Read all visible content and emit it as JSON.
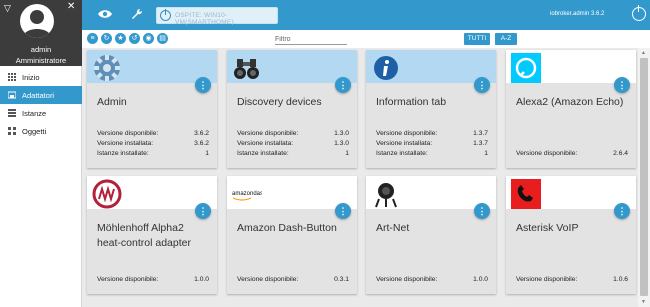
{
  "profile": {
    "name": "admin",
    "role": "Amministratore"
  },
  "nav": [
    {
      "label": "Inizio",
      "icon": "grid-icon"
    },
    {
      "label": "Adattatori",
      "icon": "store-icon",
      "active": true
    },
    {
      "label": "Istanze",
      "icon": "list-icon"
    },
    {
      "label": "Oggetti",
      "icon": "objects-icon"
    }
  ],
  "header": {
    "host_label": "OSPITE: WIN10-VM(SMARTHOME)",
    "account": "iobroker.admin 3.6.2"
  },
  "toolbar": {
    "filter_placeholder": "Filtro",
    "btn_all": "TUTTI",
    "btn_sort": "A-Z"
  },
  "labels": {
    "available": "Versione disponibile:",
    "installed": "Versione installata:",
    "instances": "Istanze installate:"
  },
  "cards": [
    {
      "title": "Admin",
      "available": "3.6.2",
      "installed": "3.6.2",
      "instances": "1",
      "logo": "gear-logo",
      "installed_flag": true
    },
    {
      "title": "Discovery devices",
      "available": "1.3.0",
      "installed": "1.3.0",
      "instances": "1",
      "logo": "binoculars-logo",
      "installed_flag": true
    },
    {
      "title": "Information tab",
      "available": "1.3.7",
      "installed": "1.3.7",
      "instances": "1",
      "logo": "info-logo",
      "installed_flag": true
    },
    {
      "title": "Alexa2 (Amazon Echo)",
      "available": "2.6.4",
      "logo": "alexa-logo"
    },
    {
      "title_line1": "Möhlenhoff Alpha2",
      "title_line2": "heat-control adapter",
      "available": "1.0.0",
      "logo": "alpha2-logo"
    },
    {
      "title": "Amazon Dash-Button",
      "available": "0.3.1",
      "logo": "amazon-dash-logo",
      "logo_text": "amazondash"
    },
    {
      "title": "Art-Net",
      "available": "1.0.0",
      "logo": "spotlight-logo"
    },
    {
      "title": "Asterisk VoIP",
      "available": "1.0.6",
      "logo": "asterisk-logo"
    }
  ],
  "colors": {
    "accent": "#3399cc",
    "installed_header": "#b3d9f2",
    "card_body": "#e3e3e3",
    "sidebar_dark": "#3c3c3c"
  }
}
